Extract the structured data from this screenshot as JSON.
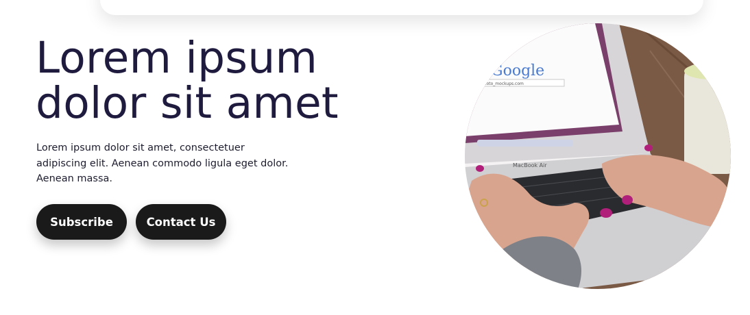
{
  "hero": {
    "title_line1": "Lorem ipsum",
    "title_line2": "dolor sit amet",
    "description": "Lorem ipsum dolor sit amet, consectetuer adipiscing elit. Aenean commodo ligula eget dolor. Aenean massa.",
    "subscribe_label": "Subscribe",
    "contact_label": "Contact Us"
  },
  "photo": {
    "screen_logo": "Google",
    "screen_url": "photo_mockups.com",
    "laptop_brand": "MacBook Air"
  },
  "colors": {
    "title": "#1f1b3f",
    "button_bg": "#1a1a1a",
    "button_text": "#ffffff"
  }
}
